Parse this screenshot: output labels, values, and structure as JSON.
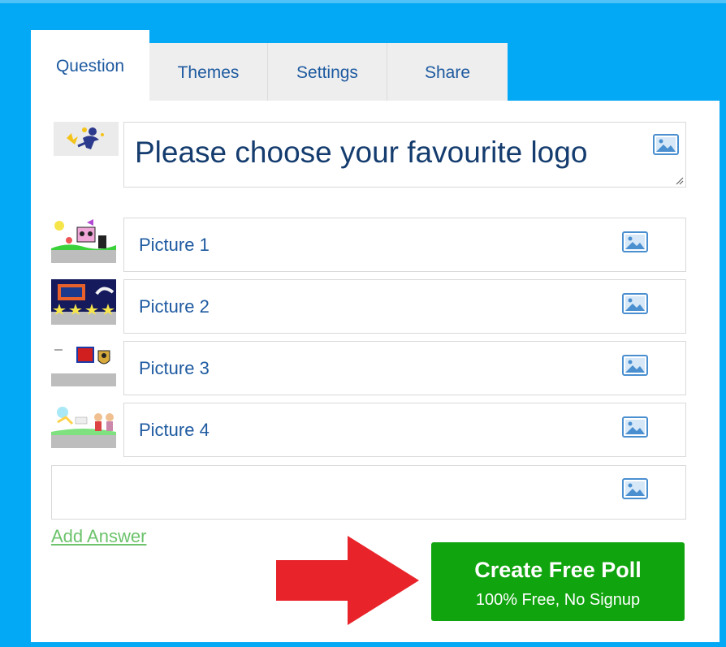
{
  "tabs": [
    {
      "label": "Question",
      "active": true
    },
    {
      "label": "Themes",
      "active": false
    },
    {
      "label": "Settings",
      "active": false
    },
    {
      "label": "Share",
      "active": false
    }
  ],
  "question": {
    "text": "Please choose your favourite logo",
    "icon": "image-icon"
  },
  "answers": [
    {
      "label": "Picture 1",
      "icon": "image-icon"
    },
    {
      "label": "Picture 2",
      "icon": "image-icon"
    },
    {
      "label": "Picture 3",
      "icon": "image-icon"
    },
    {
      "label": "Picture 4",
      "icon": "image-icon"
    },
    {
      "label": "",
      "icon": "image-icon"
    }
  ],
  "add_answer_label": "Add Answer",
  "create_button": {
    "title": "Create Free Poll",
    "subtitle": "100% Free, No Signup"
  },
  "colors": {
    "background": "#03a9f4",
    "tab_text": "#1e5aa0",
    "button_green": "#10a40e",
    "link_green": "#6cc36c",
    "arrow_red": "#e8232a"
  }
}
